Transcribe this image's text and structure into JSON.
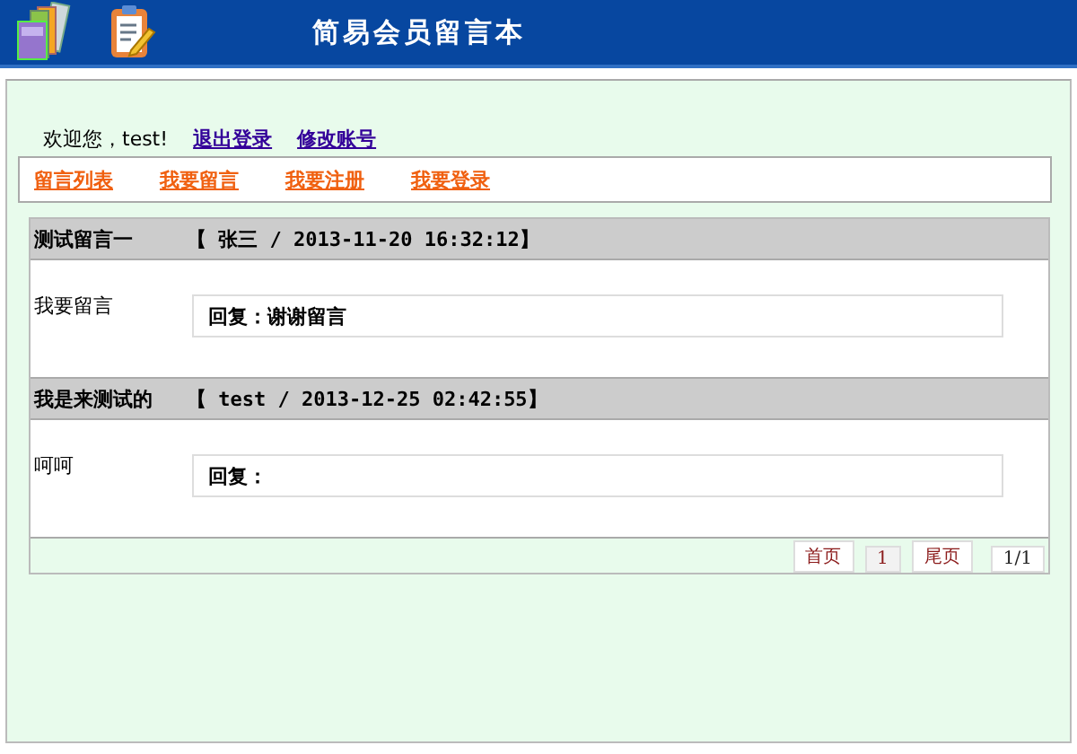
{
  "header": {
    "title": "简易会员留言本"
  },
  "user_bar": {
    "welcome": "欢迎您，test!",
    "links": [
      "退出登录",
      "修改账号"
    ]
  },
  "nav": [
    "留言列表",
    "我要留言",
    "我要注册",
    "我要登录"
  ],
  "messages": [
    {
      "title": "测试留言一",
      "meta": "【 张三 / 2013-11-20 16:32:12】",
      "body": "我要留言",
      "reply": "回复：谢谢留言"
    },
    {
      "title": "我是来测试的",
      "meta": "【 test / 2013-12-25 02:42:55】",
      "body": "呵呵",
      "reply": "回复："
    }
  ],
  "pager": {
    "first": "首页",
    "pages": [
      "1"
    ],
    "last": "尾页",
    "count": "1/1"
  }
}
